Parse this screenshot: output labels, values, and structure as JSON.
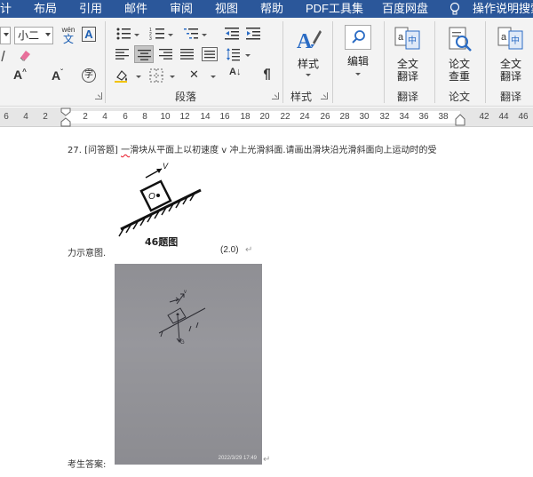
{
  "menu": {
    "items": [
      "计",
      "布局",
      "引用",
      "邮件",
      "审阅",
      "视图",
      "帮助",
      "PDF工具集",
      "百度网盘"
    ],
    "tell_me": "操作说明搜索"
  },
  "ribbon": {
    "font_size": "小二",
    "phonetic": "wén",
    "phonetic_char": "文",
    "char_border": "A",
    "grow_font": "A",
    "enclose_char": "字",
    "sort_label": "A↓",
    "paragraph_group": "段落",
    "styles_button": "样式",
    "styles_group": "样式",
    "edit_button": "编辑",
    "full_translate": [
      "全文",
      "翻译"
    ],
    "translate_group": "翻译",
    "paper_check": [
      "论文",
      "查重"
    ],
    "paper_group": "论文",
    "full_translate2": [
      "全文",
      "翻译"
    ],
    "translate_group2": "翻译"
  },
  "ruler": {
    "ticks": [
      "6",
      "4",
      "2",
      "2",
      "4",
      "6",
      "8",
      "10",
      "12",
      "14",
      "16",
      "18",
      "20",
      "22",
      "24",
      "26",
      "28",
      "30",
      "32",
      "34",
      "36",
      "38",
      "42",
      "44",
      "46"
    ]
  },
  "document": {
    "number": "27.",
    "type": "[问答题]",
    "underlined": "一",
    "question_rest": "滑块从平面上以初速度 v 冲上光滑斜面.请画出滑块沿光滑斜面向上运动时的受",
    "figure_label_v": "V",
    "figure_label_o": "O",
    "figure_caption": "46题图",
    "line2": "力示意图.",
    "score": "(2.0)",
    "return_mark": "↵",
    "photo_timestamp": "2022/3/29 17:49",
    "answer_label": "考生答案:"
  }
}
